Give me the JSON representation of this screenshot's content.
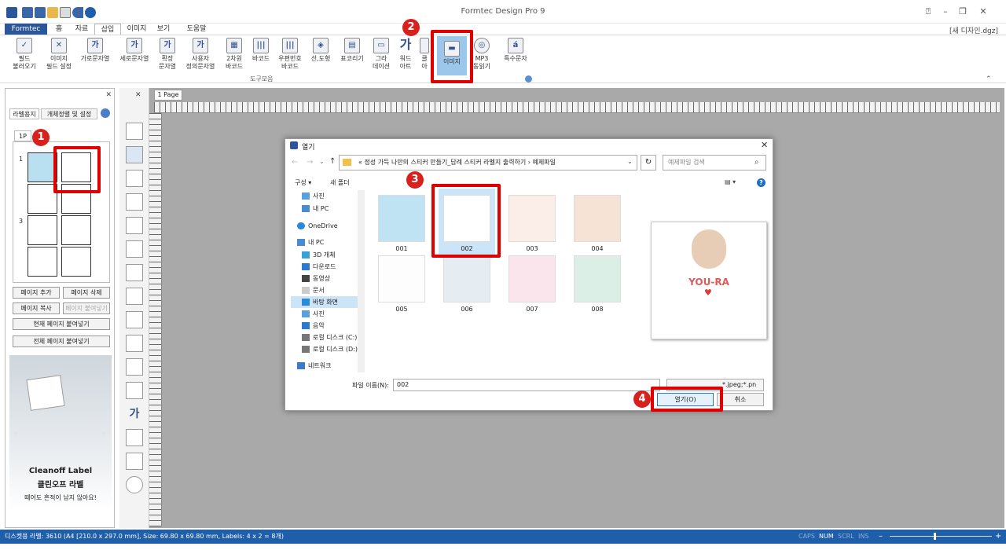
{
  "window": {
    "title": "Formtec Design Pro 9",
    "doc_name": "[새 디자인.dgz]"
  },
  "menu": {
    "formtec": "Formtec",
    "items": [
      "홈",
      "자료",
      "삽입",
      "이미지",
      "보기",
      "도움말"
    ]
  },
  "ribbon": {
    "buttons": [
      "필드\n불러오기",
      "이미지\n필드 설정",
      "가로문자열",
      "세로문자열",
      "확장\n문자열",
      "사용자\n정의문자열",
      "2차원\n바코드",
      "바코드",
      "우편번호\n바코드",
      "선,도형",
      "표코리기",
      "그라\n데이션",
      "워드\n아트",
      "클\n아",
      "이미지",
      "MP3\n동읽기",
      "특수문자"
    ],
    "group_label": "도구모음"
  },
  "left_panel": {
    "tabs": [
      "라벨용지",
      "개체정렬 및 설정"
    ],
    "page_tab": "1P",
    "row_labels": [
      "1",
      "3"
    ],
    "buttons": [
      "페이지 추가",
      "페이지 삭제",
      "페이지 복사",
      "페이지 붙여넣기",
      "현재 페이지 붙여넣기",
      "전체 페이지 붙여넣기"
    ],
    "ad": {
      "brand": "Cleanoff Label",
      "brand_kr": "클린오프 라벨",
      "tagline": "떼어도 흔적이 남지 않아요!"
    }
  },
  "page_tab": "1 Page",
  "dialog": {
    "title": "열기",
    "breadcrumb": "« 정성 가득 나만의 스티커 만들기_답례 스티커 라벨지 출력하기 › 예제파일",
    "search_placeholder": "예제파일 검색",
    "toolbar": {
      "organize": "구성 ▾",
      "new_folder": "새 폴더"
    },
    "nav_items": [
      "사진",
      "내 PC",
      "OneDrive",
      "내 PC",
      "3D 개체",
      "다운로드",
      "동영상",
      "문서",
      "바탕 화면",
      "사진",
      "음악",
      "로컬 디스크 (C:)",
      "로컬 디스크 (D:)",
      "네트워크"
    ],
    "files": [
      "001",
      "002",
      "003",
      "004",
      "005",
      "006",
      "007",
      "008"
    ],
    "filename_label": "파일 이름(N):",
    "filename_value": "002",
    "filetype_value": "*.jpeg;*.pn",
    "open_label": "열기(O)",
    "cancel_label": "취소",
    "preview_text": "YOU-RA"
  },
  "callouts": [
    "1",
    "2",
    "3",
    "4"
  ],
  "status": {
    "left": "디스켓용 라벨: 3610 (A4 [210.0 x 297.0 mm], Size: 69.80 x 69.80 mm, Labels: 4 x 2 = 8개)",
    "indicators": [
      "CAPS",
      "NUM",
      "SCRL",
      "INS"
    ]
  }
}
